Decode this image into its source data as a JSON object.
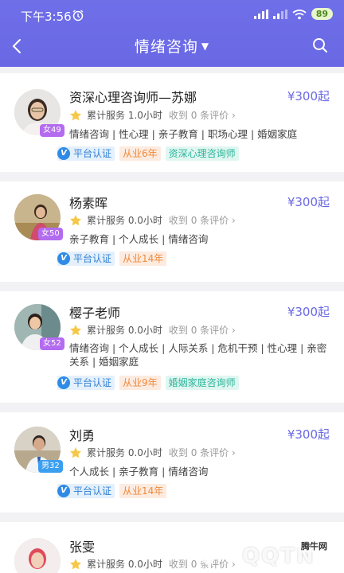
{
  "status": {
    "time": "下午3:56",
    "battery": "89"
  },
  "nav": {
    "title": "情绪咨询"
  },
  "cards": [
    {
      "name": "资深心理咨询师—苏娜",
      "price": "¥300起",
      "age": "女49",
      "service": "累计服务 1.0小时",
      "review": "收到 0 条评价 ›",
      "tags": "情绪咨询 | 性心理 | 亲子教育 | 职场心理 | 婚姻家庭",
      "platform": "平台认证",
      "years": "从业6年",
      "title": "资深心理咨询师"
    },
    {
      "name": "杨素晖",
      "price": "¥300起",
      "age": "女50",
      "service": "累计服务 0.0小时",
      "review": "收到 0 条评价 ›",
      "tags": "亲子教育 | 个人成长 | 情绪咨询",
      "platform": "平台认证",
      "years": "从业14年"
    },
    {
      "name": "樱子老师",
      "price": "¥300起",
      "age": "女52",
      "service": "累计服务 0.0小时",
      "review": "收到 0 条评价 ›",
      "tags": "情绪咨询 | 个人成长 | 人际关系 | 危机干预 | 性心理 | 亲密关系 | 婚姻家庭",
      "platform": "平台认证",
      "years": "从业9年",
      "title": "婚姻家庭咨询师"
    },
    {
      "name": "刘勇",
      "price": "¥300起",
      "age": "男32",
      "service": "累计服务 0.0小时",
      "review": "收到 0 条评价 ›",
      "tags": "个人成长 | 亲子教育 | 情绪咨询",
      "platform": "平台认证",
      "years": "从业14年"
    },
    {
      "name": "张雯",
      "service": "累计服务 0.0小时",
      "review": "收到 0 条评价 ›"
    }
  ],
  "watermark": {
    "text": "QQTN",
    "site": "腾牛网"
  },
  "colors": {
    "header": "#6a68e4",
    "price": "#6a68e4",
    "platform": "#2f7fd6",
    "years": "#ef8a3c",
    "title": "#2cb59a"
  }
}
